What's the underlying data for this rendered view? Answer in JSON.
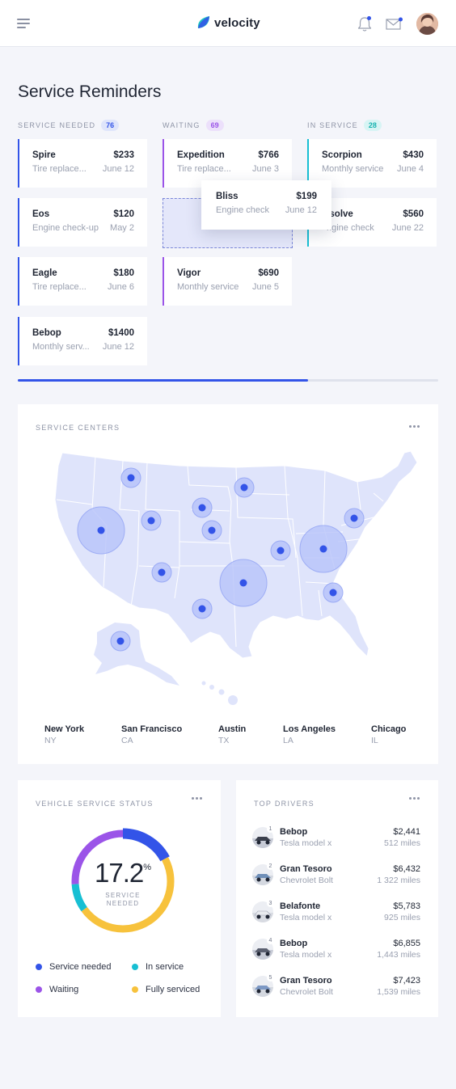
{
  "app": {
    "name": "velocity"
  },
  "header": {
    "menu_icon": "hamburger-menu-icon",
    "bell_icon": "bell-icon",
    "mail_icon": "mail-icon",
    "notification_color": "#3354e8"
  },
  "reminders": {
    "title": "Service Reminders",
    "columns": [
      {
        "label": "SERVICE NEEDED",
        "count": "76",
        "color": "#3354e8",
        "cards": [
          {
            "name": "Spire",
            "price": "$233",
            "desc": "Tire replace...",
            "date": "June 12"
          },
          {
            "name": "Eos",
            "price": "$120",
            "desc": "Engine check-up",
            "date": "May 2"
          },
          {
            "name": "Eagle",
            "price": "$180",
            "desc": "Tire replace...",
            "date": "June 6"
          },
          {
            "name": "Bebop",
            "price": "$1400",
            "desc": "Monthly serv...",
            "date": "June 12"
          }
        ]
      },
      {
        "label": "WAITING",
        "count": "69",
        "color": "#9b54e8",
        "cards": [
          {
            "name": "Expedition",
            "price": "$766",
            "desc": "Tire replace...",
            "date": "June 3"
          },
          {
            "name": "Vigor",
            "price": "$690",
            "desc": "Monthly service",
            "date": "June 5"
          }
        ]
      },
      {
        "label": "IN SERVICE",
        "count": "28",
        "color": "#17bfd3",
        "cards": [
          {
            "name": "Scorpion",
            "price": "$430",
            "desc": "Monthly service",
            "date": "June 4"
          },
          {
            "name": "esolve",
            "price": "$560",
            "desc": "ngine check",
            "date": "June 22"
          }
        ]
      }
    ],
    "dragging_card": {
      "name": "Bliss",
      "price": "$199",
      "desc": "Engine check",
      "date": "June 12"
    },
    "scroll_progress": 0.69
  },
  "service_centers": {
    "title": "SERVICE CENTERS",
    "cities": [
      {
        "name": "New York",
        "state": "NY"
      },
      {
        "name": "San Francisco",
        "state": "CA"
      },
      {
        "name": "Austin",
        "state": "TX"
      },
      {
        "name": "Los Angeles",
        "state": "LA"
      },
      {
        "name": "Chicago",
        "state": "IL"
      }
    ]
  },
  "vehicle_status": {
    "title": "VEHICLE SERVICE STATUS",
    "value": "17.2",
    "unit": "%",
    "caption_line1": "SERVICE",
    "caption_line2": "NEEDED",
    "segments": [
      {
        "label": "Service needed",
        "color": "#3354e8",
        "fraction": 0.172
      },
      {
        "label": "Waiting",
        "color": "#9b54e8",
        "fraction": 0.26
      },
      {
        "label": "In service",
        "color": "#17bfd3",
        "fraction": 0.09
      },
      {
        "label": "Fully serviced",
        "color": "#f7c23c",
        "fraction": 0.478
      }
    ]
  },
  "top_drivers": {
    "title": "TOP DRIVERS",
    "drivers": [
      {
        "rank": "1",
        "name": "Bebop",
        "model": "Tesla model x",
        "amount": "$2,441",
        "miles": "512 miles"
      },
      {
        "rank": "2",
        "name": "Gran Tesoro",
        "model": "Chevrolet Bolt",
        "amount": "$6,432",
        "miles": "1 322 miles"
      },
      {
        "rank": "3",
        "name": "Belafonte",
        "model": "Tesla model x",
        "amount": "$5,783",
        "miles": "925 miles"
      },
      {
        "rank": "4",
        "name": "Bebop",
        "model": "Tesla model x",
        "amount": "$6,855",
        "miles": "1,443 miles"
      },
      {
        "rank": "5",
        "name": "Gran Tesoro",
        "model": "Chevrolet Bolt",
        "amount": "$7,423",
        "miles": "1,539 miles"
      }
    ]
  }
}
